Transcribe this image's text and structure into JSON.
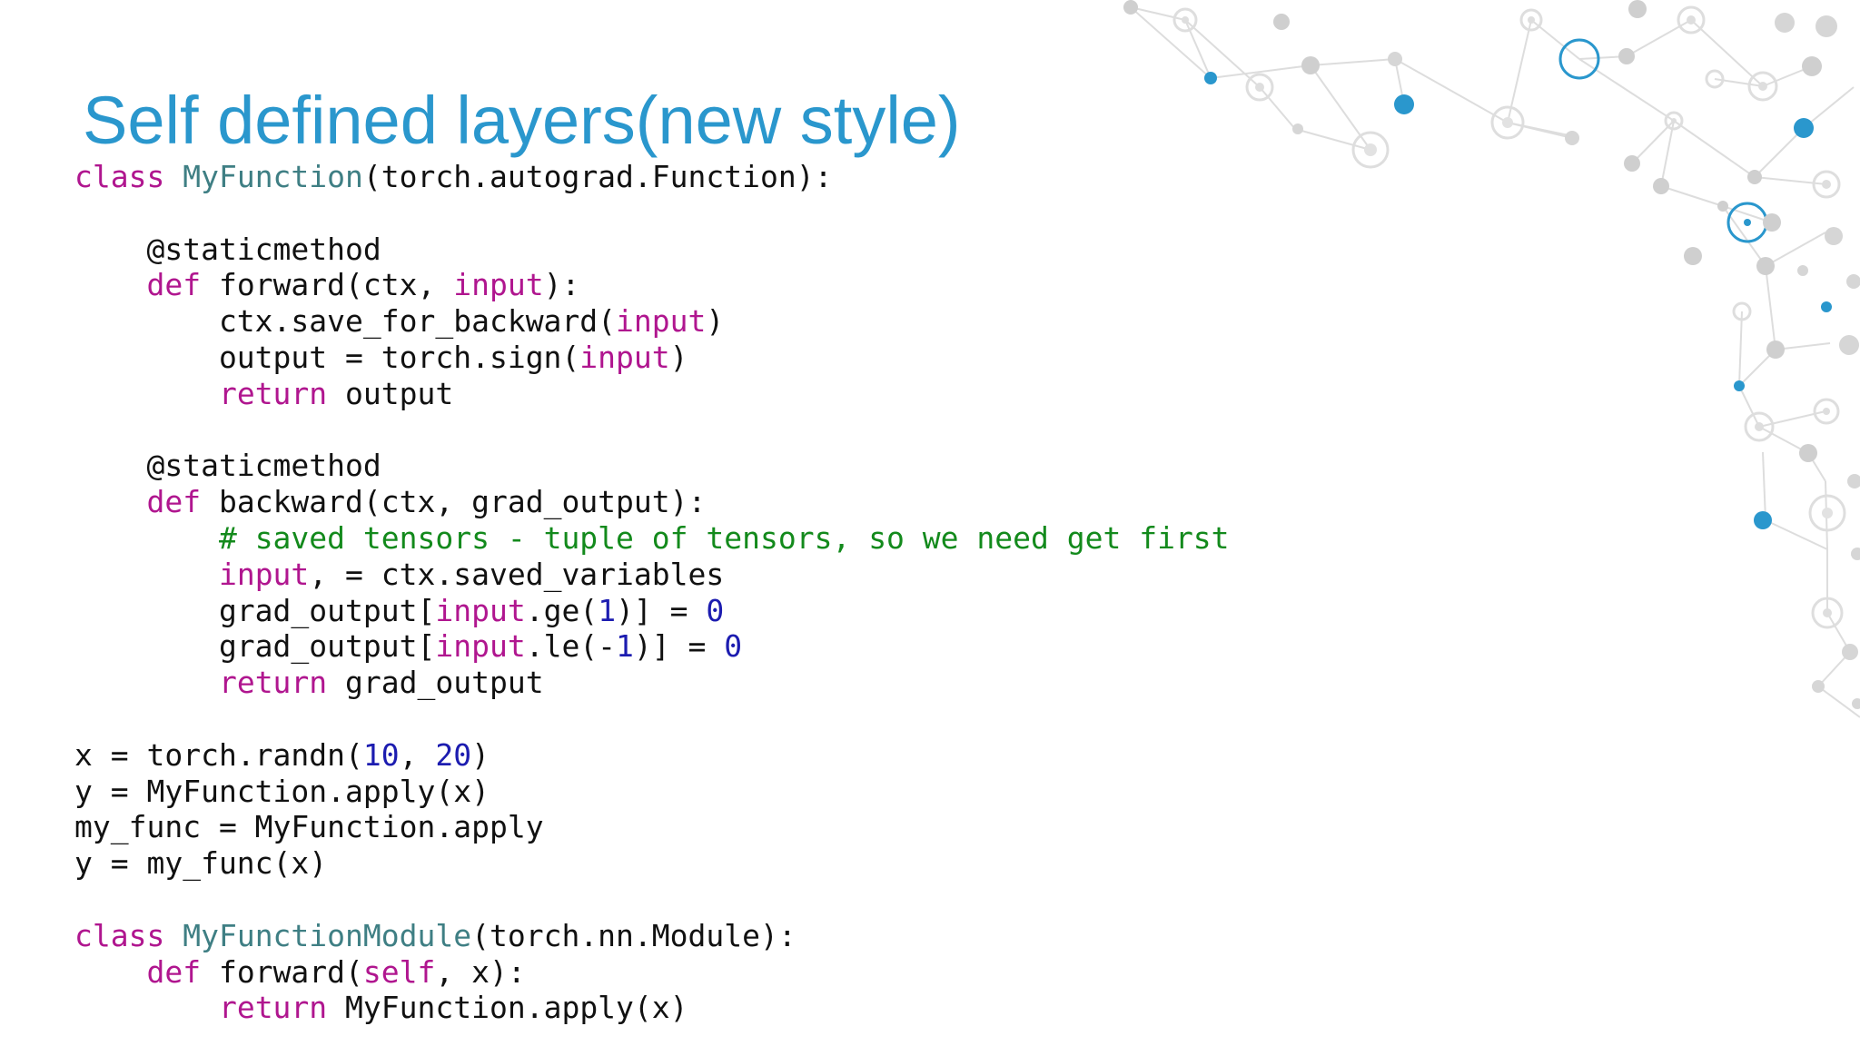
{
  "slide": {
    "title": "Self defined layers(new style)"
  },
  "colors": {
    "title": "#2a97cd",
    "keyword": "#b0168f",
    "class_name": "#3f7f84",
    "number": "#1c1cb0",
    "comment": "#138a1c",
    "text": "#111111",
    "network_accent": "#2a97cd",
    "network_gray": "#c4c4c4"
  },
  "background": {
    "decoration": "network-graph-icon"
  },
  "code": {
    "language": "python",
    "lines": [
      [
        {
          "t": "kw",
          "s": "class"
        },
        {
          "t": "plain",
          "s": " "
        },
        {
          "t": "cls",
          "s": "MyFunction"
        },
        {
          "t": "plain",
          "s": "(torch.autograd.Function):"
        }
      ],
      [],
      [
        {
          "t": "plain",
          "s": "    @staticmethod"
        }
      ],
      [
        {
          "t": "plain",
          "s": "    "
        },
        {
          "t": "kw",
          "s": "def"
        },
        {
          "t": "plain",
          "s": " forward(ctx, "
        },
        {
          "t": "kw",
          "s": "input"
        },
        {
          "t": "plain",
          "s": "):"
        }
      ],
      [
        {
          "t": "plain",
          "s": "        ctx.save_for_backward("
        },
        {
          "t": "kw",
          "s": "input"
        },
        {
          "t": "plain",
          "s": ")"
        }
      ],
      [
        {
          "t": "plain",
          "s": "        output = torch.sign("
        },
        {
          "t": "kw",
          "s": "input"
        },
        {
          "t": "plain",
          "s": ")"
        }
      ],
      [
        {
          "t": "plain",
          "s": "        "
        },
        {
          "t": "kw",
          "s": "return"
        },
        {
          "t": "plain",
          "s": " output"
        }
      ],
      [],
      [
        {
          "t": "plain",
          "s": "    @staticmethod"
        }
      ],
      [
        {
          "t": "plain",
          "s": "    "
        },
        {
          "t": "kw",
          "s": "def"
        },
        {
          "t": "plain",
          "s": " backward(ctx, grad_output):"
        }
      ],
      [
        {
          "t": "plain",
          "s": "        "
        },
        {
          "t": "cmt",
          "s": "# saved tensors - tuple of tensors, so we need get first"
        }
      ],
      [
        {
          "t": "plain",
          "s": "        "
        },
        {
          "t": "kw",
          "s": "input"
        },
        {
          "t": "plain",
          "s": ", = ctx.saved_variables"
        }
      ],
      [
        {
          "t": "plain",
          "s": "        grad_output["
        },
        {
          "t": "kw",
          "s": "input"
        },
        {
          "t": "plain",
          "s": ".ge("
        },
        {
          "t": "num",
          "s": "1"
        },
        {
          "t": "plain",
          "s": ")] = "
        },
        {
          "t": "num",
          "s": "0"
        }
      ],
      [
        {
          "t": "plain",
          "s": "        grad_output["
        },
        {
          "t": "kw",
          "s": "input"
        },
        {
          "t": "plain",
          "s": ".le(-"
        },
        {
          "t": "num",
          "s": "1"
        },
        {
          "t": "plain",
          "s": ")] = "
        },
        {
          "t": "num",
          "s": "0"
        }
      ],
      [
        {
          "t": "plain",
          "s": "        "
        },
        {
          "t": "kw",
          "s": "return"
        },
        {
          "t": "plain",
          "s": " grad_output"
        }
      ],
      [],
      [
        {
          "t": "plain",
          "s": "x = torch.randn("
        },
        {
          "t": "num",
          "s": "10"
        },
        {
          "t": "plain",
          "s": ", "
        },
        {
          "t": "num",
          "s": "20"
        },
        {
          "t": "plain",
          "s": ")"
        }
      ],
      [
        {
          "t": "plain",
          "s": "y = MyFunction.apply(x)"
        }
      ],
      [
        {
          "t": "plain",
          "s": "my_func = MyFunction.apply"
        }
      ],
      [
        {
          "t": "plain",
          "s": "y = my_func(x)"
        }
      ],
      [],
      [
        {
          "t": "kw",
          "s": "class"
        },
        {
          "t": "plain",
          "s": " "
        },
        {
          "t": "cls",
          "s": "MyFunctionModule"
        },
        {
          "t": "plain",
          "s": "(torch.nn.Module):"
        }
      ],
      [
        {
          "t": "plain",
          "s": "    "
        },
        {
          "t": "kw",
          "s": "def"
        },
        {
          "t": "plain",
          "s": " forward("
        },
        {
          "t": "kw",
          "s": "self"
        },
        {
          "t": "plain",
          "s": ", x):"
        }
      ],
      [
        {
          "t": "plain",
          "s": "        "
        },
        {
          "t": "kw",
          "s": "return"
        },
        {
          "t": "plain",
          "s": " MyFunction.apply(x)"
        }
      ]
    ]
  }
}
